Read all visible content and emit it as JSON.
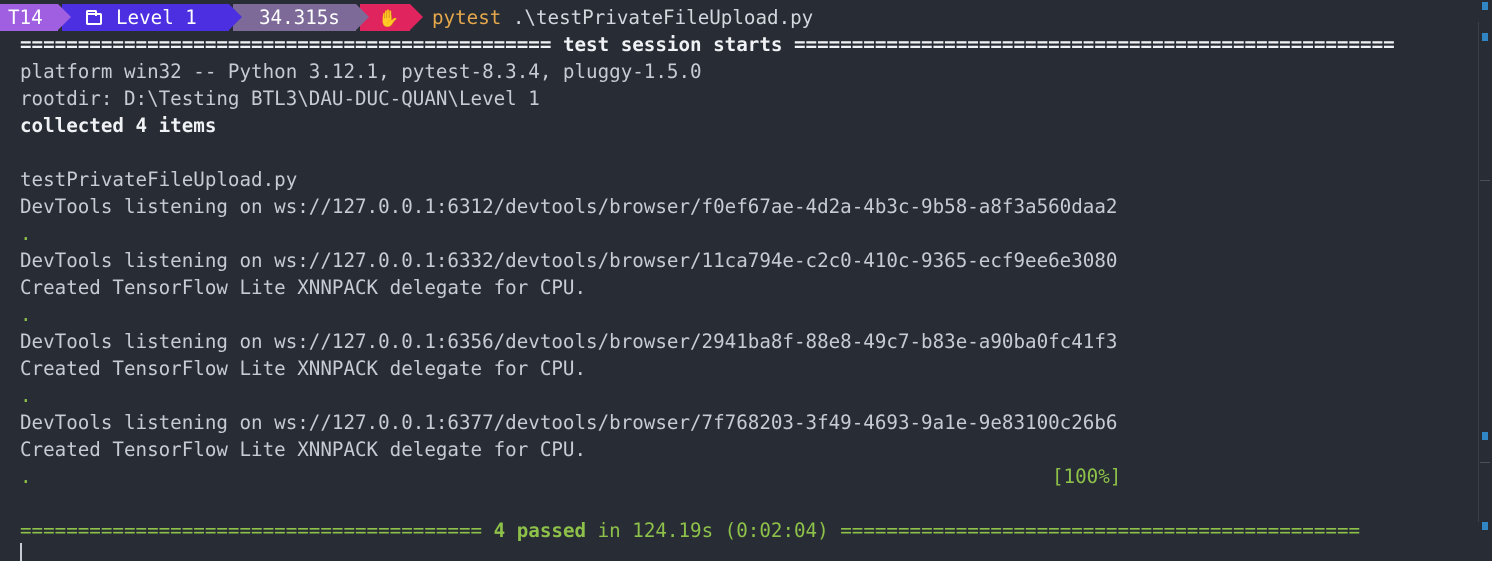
{
  "prompt": {
    "shell_label": "T14",
    "folder_icon": "folder-icon",
    "directory": "Level 1",
    "duration": "34.315s",
    "status_icon": "stop-hand-icon",
    "command": "pytest",
    "argument": ".\\testPrivateFileUpload.py",
    "colors": {
      "shell": "#9f5fe0",
      "directory": "#4b2fe0",
      "duration": "#7d6a99",
      "status": "#e0245e",
      "command": "#e5a84b"
    }
  },
  "output": {
    "session_header_left": "============================================== ",
    "session_header_title": "test session starts",
    "session_header_right": " ====================================================",
    "platform": "platform win32 -- Python 3.12.1, pytest-8.3.4, pluggy-1.5.0",
    "rootdir": "rootdir: D:\\Testing BTL3\\DAU-DUC-QUAN\\Level 1",
    "collected": "collected 4 items",
    "test_file": "testPrivateFileUpload.py",
    "devtools_1": "DevTools listening on ws://127.0.0.1:6312/devtools/browser/f0ef67ae-4d2a-4b3c-9b58-a8f3a560daa2",
    "dot_1": ".",
    "devtools_2": "DevTools listening on ws://127.0.0.1:6332/devtools/browser/11ca794e-c2c0-410c-9365-ecf9ee6e3080",
    "tflite_1": "Created TensorFlow Lite XNNPACK delegate for CPU.",
    "dot_2": ".",
    "devtools_3": "DevTools listening on ws://127.0.0.1:6356/devtools/browser/2941ba8f-88e8-49c7-b83e-a90ba0fc41f3",
    "tflite_2": "Created TensorFlow Lite XNNPACK delegate for CPU.",
    "dot_3": ".",
    "devtools_4": "DevTools listening on ws://127.0.0.1:6377/devtools/browser/7f768203-3f49-4693-9a1e-9e83100c26b6",
    "tflite_3": "Created TensorFlow Lite XNNPACK delegate for CPU.",
    "dot_4": ".",
    "percent": "[100%]",
    "summary_left": "======================================== ",
    "summary_passed": "4 passed",
    "summary_time": " in 124.19s (0:02:04) ",
    "summary_right": "============================================="
  }
}
